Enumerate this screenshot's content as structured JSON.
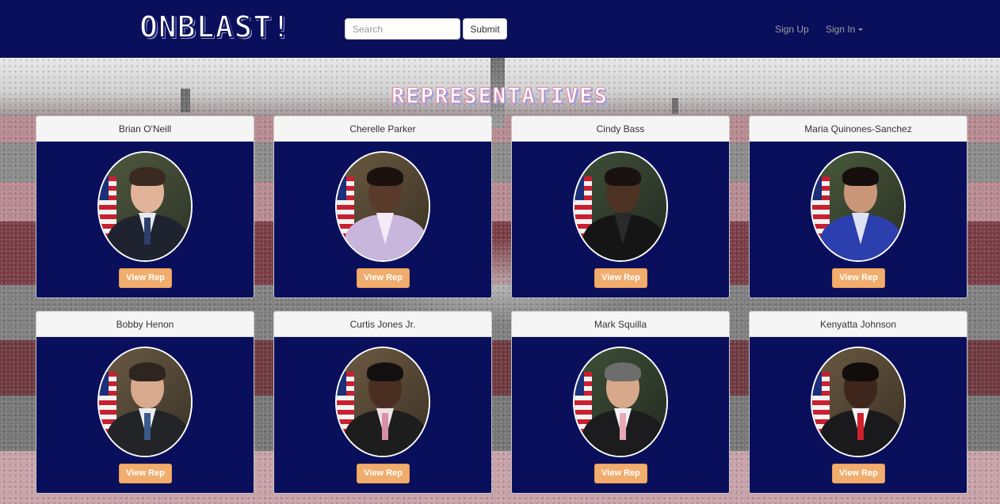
{
  "nav": {
    "logo": "ONBLAST!",
    "search_placeholder": "Search",
    "submit_label": "Submit",
    "sign_up": "Sign Up",
    "sign_in": "Sign In"
  },
  "section_title": "REPRESENTATIVES",
  "view_label": "View Rep",
  "colors": {
    "navbar": "#0a0f5c",
    "card_body": "#0a0f5c",
    "button": "#f0ad6e"
  },
  "reps": [
    {
      "name": "Brian O'Neill"
    },
    {
      "name": "Cherelle Parker"
    },
    {
      "name": "Cindy Bass"
    },
    {
      "name": "Maria Quinones-Sanchez"
    },
    {
      "name": "Bobby Henon"
    },
    {
      "name": "Curtis Jones Jr."
    },
    {
      "name": "Mark Squilla"
    },
    {
      "name": "Kenyatta Johnson"
    }
  ]
}
